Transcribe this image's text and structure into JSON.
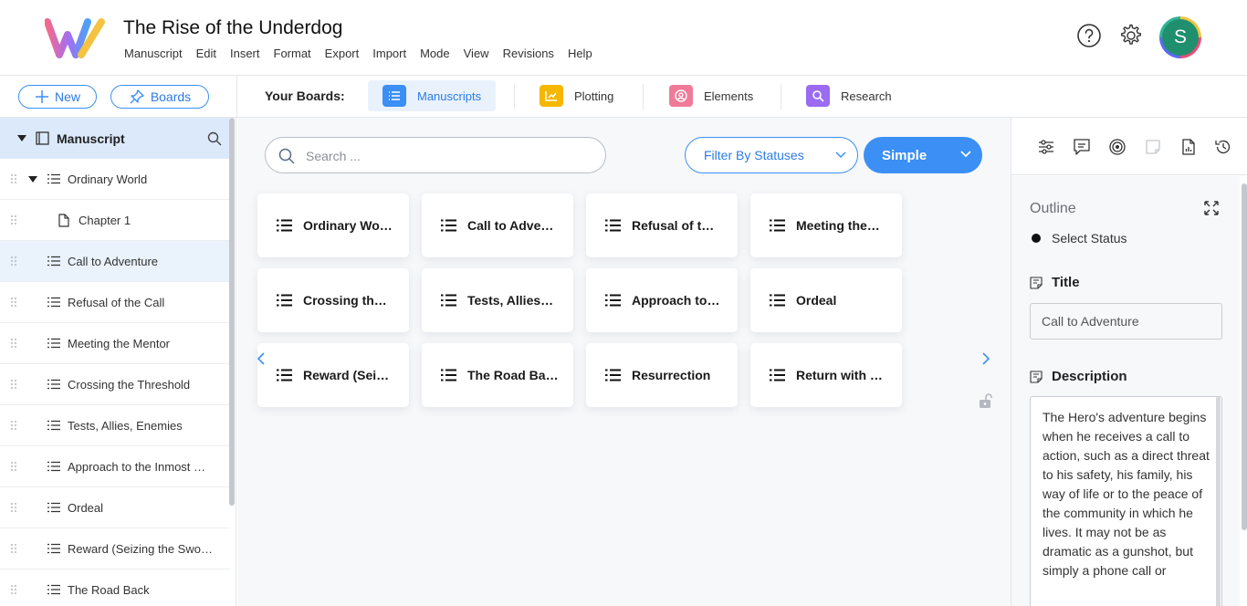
{
  "app": {
    "title": "The Rise of the Underdog",
    "menu": [
      "Manuscript",
      "Edit",
      "Insert",
      "Format",
      "Export",
      "Import",
      "Mode",
      "View",
      "Revisions",
      "Help"
    ],
    "user_initial": "S"
  },
  "toolbar": {
    "new_label": "New",
    "boards_label": "Boards",
    "your_boards_label": "Your Boards:",
    "tabs": [
      {
        "label": "Manuscripts",
        "color": "#3b8ff5",
        "active": true
      },
      {
        "label": "Plotting",
        "color": "#f5b700",
        "active": false
      },
      {
        "label": "Elements",
        "color": "#f07a9a",
        "active": false
      },
      {
        "label": "Research",
        "color": "#9b6bf2",
        "active": false
      }
    ]
  },
  "sidebar": {
    "root_label": "Manuscript",
    "items": [
      {
        "label": "Ordinary World",
        "type": "list",
        "expanded": true
      },
      {
        "label": "Chapter 1",
        "type": "doc"
      },
      {
        "label": "Call to Adventure",
        "type": "list",
        "selected": true
      },
      {
        "label": "Refusal of the Call",
        "type": "list"
      },
      {
        "label": "Meeting the Mentor",
        "type": "list"
      },
      {
        "label": "Crossing the Threshold",
        "type": "list"
      },
      {
        "label": "Tests, Allies, Enemies",
        "type": "list"
      },
      {
        "label": "Approach to the Inmost …",
        "type": "list"
      },
      {
        "label": "Ordeal",
        "type": "list"
      },
      {
        "label": "Reward (Seizing the Swo…",
        "type": "list"
      },
      {
        "label": "The Road Back",
        "type": "list"
      }
    ]
  },
  "main": {
    "search_placeholder": "Search ...",
    "filter_label": "Filter By Statuses",
    "view_mode_label": "Simple",
    "cards": [
      "Ordinary Wo…",
      "Call to Adve…",
      "Refusal of t…",
      "Meeting the…",
      "Crossing th…",
      "Tests, Allies…",
      "Approach to…",
      "Ordeal",
      "Reward (Sei…",
      "The Road Ba…",
      "Resurrection",
      "Return with …"
    ]
  },
  "rpanel": {
    "outline_label": "Outline",
    "status_label": "Select Status",
    "title_heading": "Title",
    "title_value": "Call to Adventure",
    "description_heading": "Description",
    "description_text": "The Hero's adventure begins when he receives a call to action, such as a direct threat to his safety, his family, his way of life or to the peace of the community in which he lives. It may not be as dramatic as a gunshot, but simply a phone call or"
  },
  "colors": {
    "accent": "#3b8ff5",
    "selected_bg": "#eaf2fc"
  }
}
